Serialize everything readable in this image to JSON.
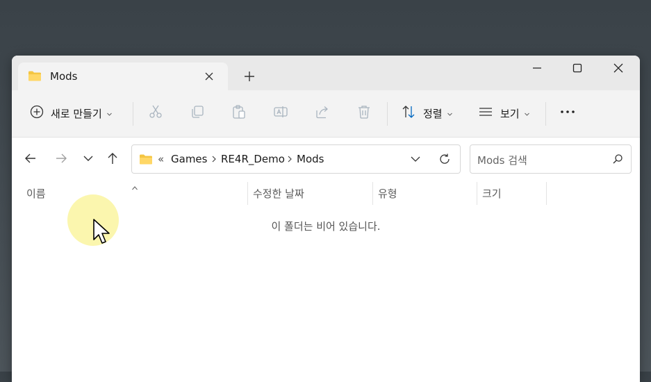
{
  "window": {
    "tab": {
      "title": "Mods",
      "icon": "folder-icon"
    },
    "controls": {
      "minimize": "minimize-icon",
      "maximize": "maximize-icon",
      "close": "close-icon"
    }
  },
  "toolbar": {
    "new_label": "새로 만들기",
    "sort_label": "정렬",
    "view_label": "보기",
    "icons": [
      "cut-icon",
      "copy-icon",
      "paste-icon",
      "rename-icon",
      "share-icon",
      "delete-icon",
      "more-icon"
    ]
  },
  "address": {
    "overflow": "«",
    "crumbs": [
      "Games",
      "RE4R_Demo",
      "Mods"
    ]
  },
  "search": {
    "placeholder": "Mods 검색"
  },
  "columns": {
    "name": "이름",
    "modified": "수정한 날짜",
    "type": "유형",
    "size": "크기"
  },
  "empty_message": "이 폴더는 비어 있습니다.",
  "colors": {
    "folder": "#f4c542",
    "accent": "#0067c0"
  }
}
